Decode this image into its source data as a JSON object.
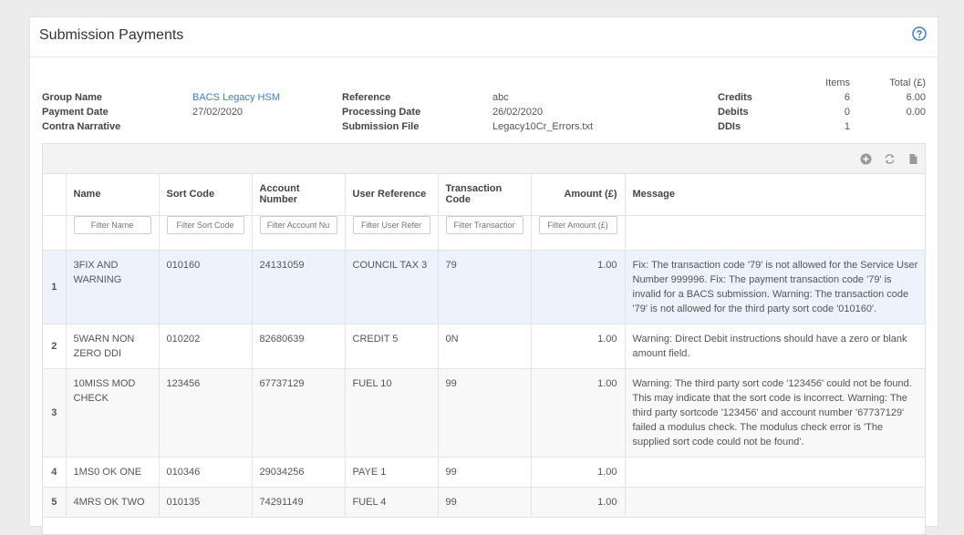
{
  "card": {
    "title": "Submission Payments"
  },
  "meta": {
    "group_name_label": "Group Name",
    "group_name": "BACS Legacy HSM",
    "payment_date_label": "Payment Date",
    "payment_date": "27/02/2020",
    "contra_narrative_label": "Contra Narrative",
    "reference_label": "Reference",
    "reference": "abc",
    "processing_date_label": "Processing Date",
    "processing_date": "26/02/2020",
    "submission_file_label": "Submission File",
    "submission_file": "Legacy10Cr_Errors.txt",
    "items_header": "Items",
    "total_header": "Total (£)",
    "credits_label": "Credits",
    "credits_items": "6",
    "credits_total": "6.00",
    "debits_label": "Debits",
    "debits_items": "0",
    "debits_total": "0.00",
    "ddis_label": "DDIs",
    "ddis_items": "1"
  },
  "toolbar": {
    "icons": [
      "add-icon",
      "refresh-icon",
      "file-icon"
    ]
  },
  "table": {
    "headers": {
      "name": "Name",
      "sort_code": "Sort Code",
      "account_number": "Account Number",
      "user_reference": "User Reference",
      "transaction_code": "Transaction Code",
      "amount": "Amount (£)",
      "message": "Message"
    },
    "filters": {
      "name": "Filter Name",
      "sort_code": "Filter Sort Code",
      "account_number": "Filter Account Nu",
      "user_reference": "Filter User Refer",
      "transaction_code": "Filter Transactior",
      "amount": "Filter Amount (£)"
    },
    "rows": [
      {
        "idx": "1",
        "name": "3FIX AND WARNING",
        "sort_code": "010160",
        "account_number": "24131059",
        "user_reference": "COUNCIL TAX 3",
        "transaction_code": "79",
        "amount": "1.00",
        "message": "Fix: The transaction code '79' is not allowed for the Service User Number 999996. Fix: The payment transaction code '79' is invalid for a BACS submission. Warning: The transaction code '79' is not allowed for the third party sort code '010160'."
      },
      {
        "idx": "2",
        "name": "5WARN NON ZERO DDI",
        "sort_code": "010202",
        "account_number": "82680639",
        "user_reference": "CREDIT 5",
        "transaction_code": "0N",
        "amount": "1.00",
        "message": "Warning: Direct Debit instructions should have a zero or blank amount field."
      },
      {
        "idx": "3",
        "name": "10MISS MOD CHECK",
        "sort_code": "123456",
        "account_number": "67737129",
        "user_reference": "FUEL 10",
        "transaction_code": "99",
        "amount": "1.00",
        "message": "Warning: The third party sort code '123456' could not be found. This may indicate that the sort code is incorrect. Warning: The third party sortcode '123456' and account number '67737129' failed a modulus check. The modulus check error is 'The supplied sort code could not be found'."
      },
      {
        "idx": "4",
        "name": "1MS0 OK ONE",
        "sort_code": "010346",
        "account_number": "29034256",
        "user_reference": "PAYE 1",
        "transaction_code": "99",
        "amount": "1.00",
        "message": ""
      },
      {
        "idx": "5",
        "name": "4MRS OK TWO",
        "sort_code": "010135",
        "account_number": "74291149",
        "user_reference": "FUEL 4",
        "transaction_code": "99",
        "amount": "1.00",
        "message": ""
      }
    ]
  }
}
